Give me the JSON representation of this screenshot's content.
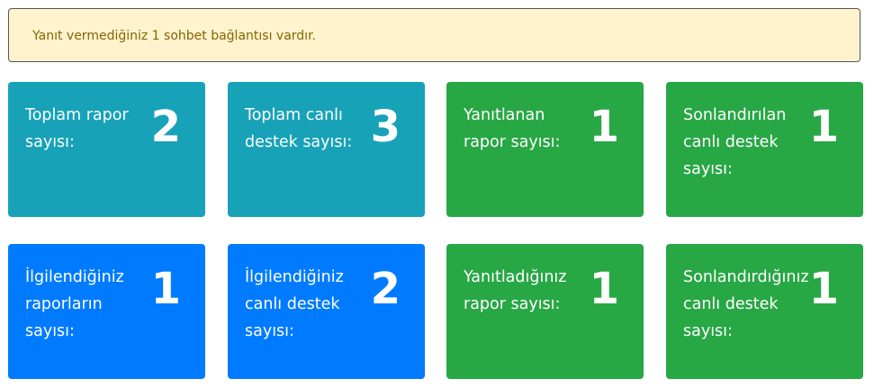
{
  "alert": {
    "text": "Yanıt vermediğiniz 1 sohbet bağlantısı vardır."
  },
  "cards": [
    {
      "label": "Toplam rapor sayısı:",
      "count": "2",
      "color": "#17a2b8"
    },
    {
      "label": "Toplam canlı destek sayısı:",
      "count": "3",
      "color": "#17a2b8"
    },
    {
      "label": "Yanıtlanan rapor sayısı:",
      "count": "1",
      "color": "#28a745"
    },
    {
      "label": "Sonlandırılan canlı destek sayısı:",
      "count": "1",
      "color": "#28a745"
    },
    {
      "label": "İlgilendiğiniz raporların sayısı:",
      "count": "1",
      "color": "#007bff"
    },
    {
      "label": "İlgilendiğiniz canlı destek sayısı:",
      "count": "2",
      "color": "#007bff"
    },
    {
      "label": "Yanıtladığınız rapor sayısı:",
      "count": "1",
      "color": "#28a745"
    },
    {
      "label": "Sonlandırdığınız canlı destek sayısı:",
      "count": "1",
      "color": "#28a745"
    }
  ]
}
